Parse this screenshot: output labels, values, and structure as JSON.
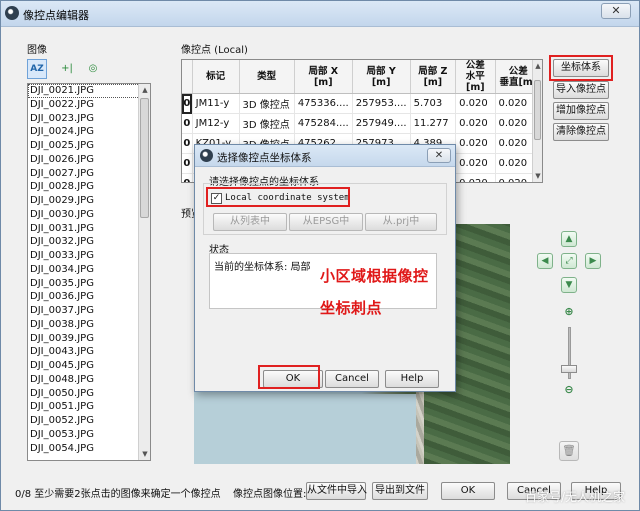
{
  "window": {
    "title": "像控点编辑器",
    "close": "✕"
  },
  "images": {
    "label": "图像",
    "tools": [
      "AZ",
      "+|",
      "◎"
    ],
    "items": [
      "DJI_0021.JPG",
      "DJI_0022.JPG",
      "DJI_0023.JPG",
      "DJI_0024.JPG",
      "DJI_0025.JPG",
      "DJI_0026.JPG",
      "DJI_0027.JPG",
      "DJI_0028.JPG",
      "DJI_0029.JPG",
      "DJI_0030.JPG",
      "DJI_0031.JPG",
      "DJI_0032.JPG",
      "DJI_0033.JPG",
      "DJI_0034.JPG",
      "DJI_0035.JPG",
      "DJI_0036.JPG",
      "DJI_0037.JPG",
      "DJI_0038.JPG",
      "DJI_0039.JPG",
      "DJI_0043.JPG",
      "DJI_0045.JPG",
      "DJI_0048.JPG",
      "DJI_0050.JPG",
      "DJI_0051.JPG",
      "DJI_0052.JPG",
      "DJI_0053.JPG",
      "DJI_0054.JPG"
    ]
  },
  "gcp": {
    "label": "像控点 (Local)",
    "columns": [
      "",
      "标记",
      "类型",
      "局部 X\n[m]",
      "局部 Y\n[m]",
      "局部 Z\n[m]",
      "公差\n水平[m]",
      "公差\n垂直[m]"
    ],
    "rows": [
      [
        "0",
        "JM11-y",
        "3D 像控点",
        "475336....",
        "257953....",
        "5.703",
        "0.020",
        "0.020"
      ],
      [
        "0",
        "JM12-y",
        "3D 像控点",
        "475284....",
        "257949....",
        "11.277",
        "0.020",
        "0.020"
      ],
      [
        "0",
        "KZ01-y",
        "3D 像控点",
        "475262....",
        "257973....",
        "4.389",
        "0.020",
        "0.020"
      ],
      [
        "0",
        "",
        "",
        "",
        "",
        "",
        "0.020",
        "0.020"
      ],
      [
        "0",
        "",
        "",
        "",
        "",
        "",
        "0.020",
        "0.020"
      ]
    ],
    "buttons": {
      "coord_system": "坐标体系",
      "import": "导入像控点",
      "add": "增加像控点",
      "clear": "清除像控点"
    }
  },
  "preview": {
    "label": "预览"
  },
  "nav": {
    "up": "▲",
    "left": "◀",
    "fit": "⤢",
    "right": "▶",
    "down": "▼",
    "zoom_in": "⊕",
    "zoom_out": "⊖",
    "delete": "🗑",
    "zoom_level": 0.2
  },
  "footer": {
    "status": "0/8 至少需要2张点击的图像来确定一个像控点",
    "location_label": "像控点图像位置:",
    "from_file": "从文件中导入",
    "export": "导出到文件",
    "ok": "OK",
    "cancel": "Cancel",
    "help": "Help"
  },
  "dialog": {
    "title": "选择像控点坐标体系",
    "prompt": "请选择像控点的坐标体系",
    "local_checkbox": "Local coordinate system",
    "local_checked": "✓",
    "from_list": "从列表中",
    "from_epsg": "从EPSG中",
    "from_prj": "从.prj中",
    "status_label": "状态",
    "status_text": "当前的坐标体系: 局部",
    "overlay_line1": "小区域根据像控",
    "overlay_line2": "坐标刺点",
    "ok": "OK",
    "cancel": "Cancel",
    "help": "Help",
    "close": "✕"
  },
  "watermark": "百家号/无人机之家",
  "colors": {
    "highlight": "#e02020",
    "nav_green": "#3c8a4d",
    "title_bar": "#c3d6ec"
  }
}
